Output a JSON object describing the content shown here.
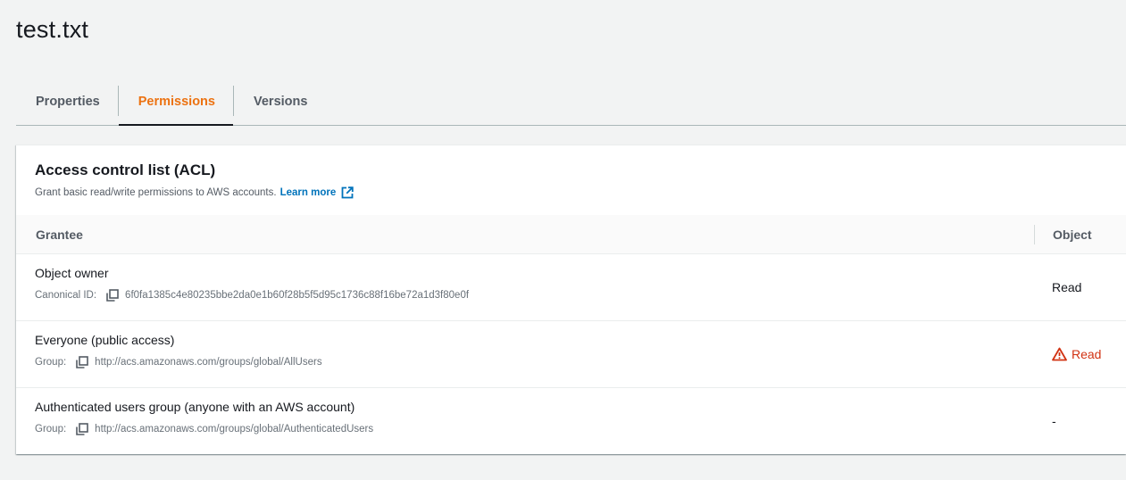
{
  "page": {
    "title": "test.txt"
  },
  "tabs": [
    {
      "label": "Properties",
      "active": false
    },
    {
      "label": "Permissions",
      "active": true
    },
    {
      "label": "Versions",
      "active": false
    }
  ],
  "acl": {
    "title": "Access control list (ACL)",
    "description": "Grant basic read/write permissions to AWS accounts.",
    "learn_more": "Learn more",
    "columns": {
      "grantee": "Grantee",
      "object": "Object"
    },
    "rows": [
      {
        "name": "Object owner",
        "id_label": "Canonical ID:",
        "id_value": "6f0fa1385c4e80235bbe2da0e1b60f28b5f5d95c1736c88f16be72a1d3f80e0f",
        "object": "Read",
        "warning": false
      },
      {
        "name": "Everyone (public access)",
        "id_label": "Group:",
        "id_value": "http://acs.amazonaws.com/groups/global/AllUsers",
        "object": "Read",
        "warning": true
      },
      {
        "name": "Authenticated users group (anyone with an AWS account)",
        "id_label": "Group:",
        "id_value": "http://acs.amazonaws.com/groups/global/AuthenticatedUsers",
        "object": "-",
        "warning": false
      }
    ]
  },
  "colors": {
    "active_tab": "#ec7211",
    "link": "#0073bb",
    "warning": "#d13212"
  }
}
